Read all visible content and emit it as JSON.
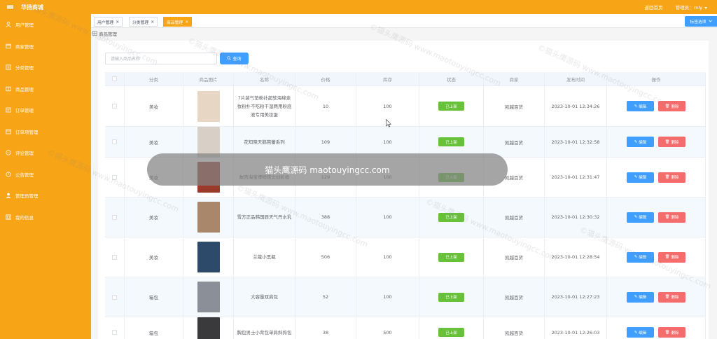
{
  "app": {
    "title": "华扬商城",
    "home_link": "返回首页",
    "admin_label": "管理员：rnly"
  },
  "sidebar": {
    "items": [
      {
        "label": "用户管理",
        "icon": "user-icon"
      },
      {
        "label": "商家管理",
        "icon": "shop-icon"
      },
      {
        "label": "分类管理",
        "icon": "category-icon"
      },
      {
        "label": "商品管理",
        "icon": "goods-icon"
      },
      {
        "label": "订单管理",
        "icon": "order-icon"
      },
      {
        "label": "订单项管理",
        "icon": "order-item-icon"
      },
      {
        "label": "评论管理",
        "icon": "comment-icon"
      },
      {
        "label": "公告管理",
        "icon": "notice-icon"
      },
      {
        "label": "管理员管理",
        "icon": "admin-icon"
      },
      {
        "label": "我的信息",
        "icon": "profile-icon"
      }
    ]
  },
  "tabs": [
    {
      "label": "用户管理",
      "close": "×",
      "active": false
    },
    {
      "label": "分类管理",
      "close": "×",
      "active": false
    },
    {
      "label": "商品管理",
      "close": "×",
      "active": true
    }
  ],
  "tab_options_label": "标签选项",
  "breadcrumb": "商品管理",
  "search": {
    "placeholder": "请输入商品名称",
    "button_label": "查询"
  },
  "table": {
    "columns": [
      "分类",
      "商品图片",
      "名称",
      "价格",
      "库存",
      "状态",
      "商家",
      "发布时间",
      "操作"
    ],
    "rows": [
      {
        "category": "美妆",
        "name": "7片装气垫粉扑超软海绵走妆粉扑不吃粉干湿两用粉底液专用美妆蛋",
        "price": "10",
        "stock": "100",
        "status": "已上架",
        "merchant": "凯越百货",
        "time": "2023-10-01 12:34:26",
        "thumb_color": "#e8d6c4"
      },
      {
        "category": "美妆",
        "name": "花知晓天鹅芭蕾系列",
        "price": "109",
        "stock": "100",
        "status": "已上架",
        "merchant": "凯越百货",
        "time": "2023-10-01 12:32:58",
        "thumb_color": "#d8cfc6"
      },
      {
        "category": "美妆",
        "name": "故宫淘宝博物馆文创彩妆",
        "price": "129",
        "stock": "100",
        "status": "已上架",
        "merchant": "凯越百货",
        "time": "2023-10-01 12:31:47",
        "thumb_color": "#9b3a2a"
      },
      {
        "category": "美妆",
        "name": "雪方正品韩国辰天气丹水乳",
        "price": "388",
        "stock": "100",
        "status": "已上架",
        "merchant": "凯越百货",
        "time": "2023-10-01 12:30:32",
        "thumb_color": "#a8876a"
      },
      {
        "category": "美妆",
        "name": "兰蔻小黑瓶",
        "price": "506",
        "stock": "100",
        "status": "已上架",
        "merchant": "凯越百货",
        "time": "2023-10-01 12:28:54",
        "thumb_color": "#2d4a6b"
      },
      {
        "category": "箱包",
        "name": "大容量双肩包",
        "price": "52",
        "stock": "100",
        "status": "已上架",
        "merchant": "凯越百货",
        "time": "2023-10-01 12:27:23",
        "thumb_color": "#8b9098"
      },
      {
        "category": "箱包",
        "name": "胸包男士小背包单肩斜挎包",
        "price": "38",
        "stock": "500",
        "status": "已上架",
        "merchant": "凯越百货",
        "time": "2023-10-01 12:26:03",
        "thumb_color": "#3a3a3c"
      }
    ],
    "edit_label": "编辑",
    "delete_label": "删除"
  },
  "toast": "猫头鹰源码 maotouyingcc.com",
  "watermark": "©猫头鹰源码 www.maotouyingcc.com"
}
